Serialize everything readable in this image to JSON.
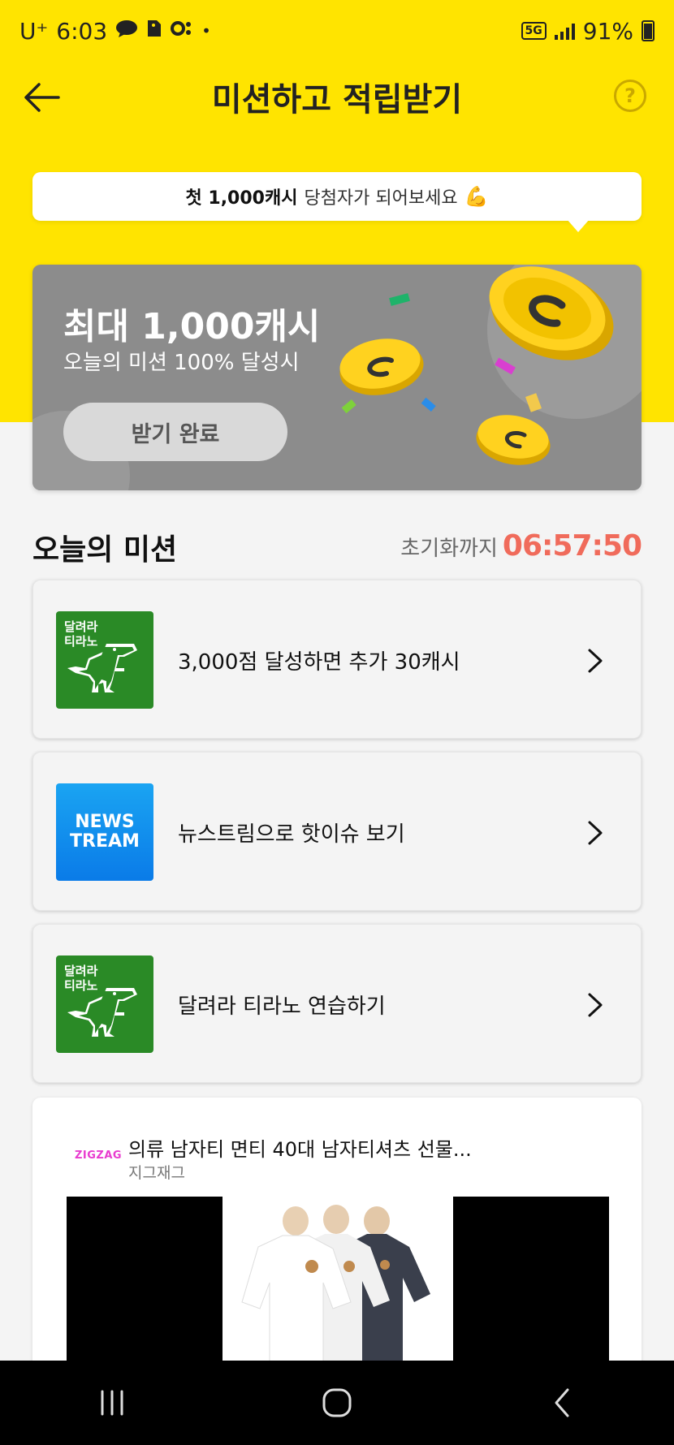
{
  "status_bar": {
    "carrier": "U⁺",
    "time": "6:03",
    "network": "5G",
    "battery": "91%"
  },
  "header": {
    "title": "미션하고 적립받기",
    "help_icon": "?"
  },
  "tooltip": {
    "bold": "첫 1,000캐시",
    "text": "당첨자가 되어보세요",
    "emoji": "💪"
  },
  "promo": {
    "title": "최대 1,000캐시",
    "subtitle": "오늘의 미션 100% 달성시",
    "button_label": "받기 완료"
  },
  "missions_section": {
    "title": "오늘의 미션",
    "reset_label": "초기화까지",
    "reset_time": "06:57:50"
  },
  "missions": [
    {
      "label": "3,000점 달성하면 추가 30캐시",
      "thumb_line1": "달려라",
      "thumb_line2": "티라노"
    },
    {
      "label": "뉴스트림으로 핫이슈 보기",
      "thumb_line1": "NEWS",
      "thumb_line2": "TREAM"
    },
    {
      "label": "달려라 티라노 연습하기",
      "thumb_line1": "달려라",
      "thumb_line2": "티라노"
    }
  ],
  "ad": {
    "logo": "ZIGZAG",
    "title": "의류 남자티 면티 40대 남자티셔츠 선물...",
    "brand": "지그재그"
  },
  "colors": {
    "brand_yellow": "#FFE400",
    "timer_red": "#f06b5b",
    "promo_gray": "#8c8c8c"
  }
}
